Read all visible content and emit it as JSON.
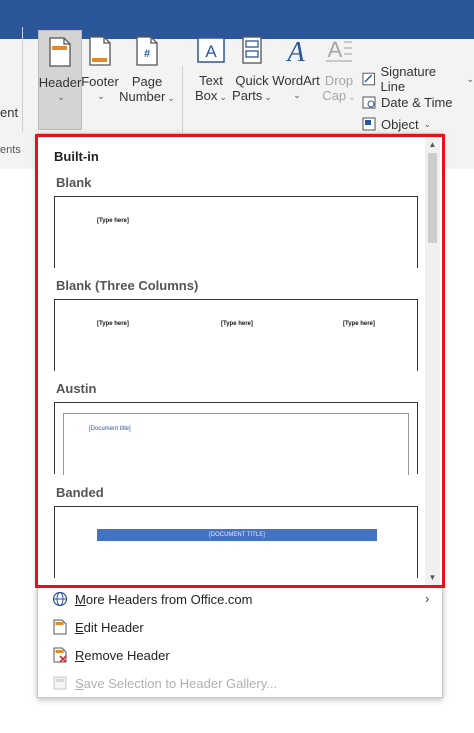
{
  "colors": {
    "titlebar": "#2b579a",
    "highlight": "#e0151b",
    "banded": "#4472c4"
  },
  "ribbon": {
    "left_cut_label": "ent",
    "left_cut_group": "ents",
    "header": {
      "label": "Header",
      "icon": "header-icon"
    },
    "footer": {
      "label": "Footer",
      "icon": "footer-icon"
    },
    "page_number": {
      "label1": "Page",
      "label2": "Number",
      "icon": "page-number-icon",
      "glyph": "#"
    },
    "text_box": {
      "label1": "Text",
      "label2": "Box",
      "icon": "text-box-icon",
      "glyph": "A"
    },
    "quick_parts": {
      "label1": "Quick",
      "label2": "Parts",
      "icon": "quick-parts-icon"
    },
    "wordart": {
      "label": "WordArt",
      "icon": "wordart-icon",
      "glyph": "A"
    },
    "drop_cap": {
      "label1": "Drop",
      "label2": "Cap",
      "icon": "drop-cap-icon",
      "glyph": "A"
    },
    "signature_line": {
      "label": "Signature Line",
      "icon": "signature-line-icon"
    },
    "date_time": {
      "label": "Date & Time",
      "icon": "date-time-icon"
    },
    "object": {
      "label": "Object",
      "icon": "object-icon"
    },
    "chevron": "⌄"
  },
  "gallery": {
    "section_title": "Built-in",
    "items": [
      {
        "title": "Blank",
        "placeholders": [
          "[Type here]"
        ]
      },
      {
        "title": "Blank (Three Columns)",
        "placeholders": [
          "[Type here]",
          "[Type here]",
          "[Type here]"
        ]
      },
      {
        "title": "Austin",
        "placeholders": [
          "[Document title]"
        ]
      },
      {
        "title": "Banded",
        "placeholders": [
          "[DOCUMENT TITLE]"
        ]
      }
    ]
  },
  "menu": {
    "more_headers": {
      "accel": "M",
      "rest": "ore Headers from Office.com",
      "arrow": "›"
    },
    "edit_header": {
      "accel": "E",
      "rest": "dit Header"
    },
    "remove_header": {
      "accel": "R",
      "rest": "emove Header"
    },
    "save_selection": {
      "accel": "S",
      "rest": "ave Selection to Header Gallery..."
    }
  }
}
